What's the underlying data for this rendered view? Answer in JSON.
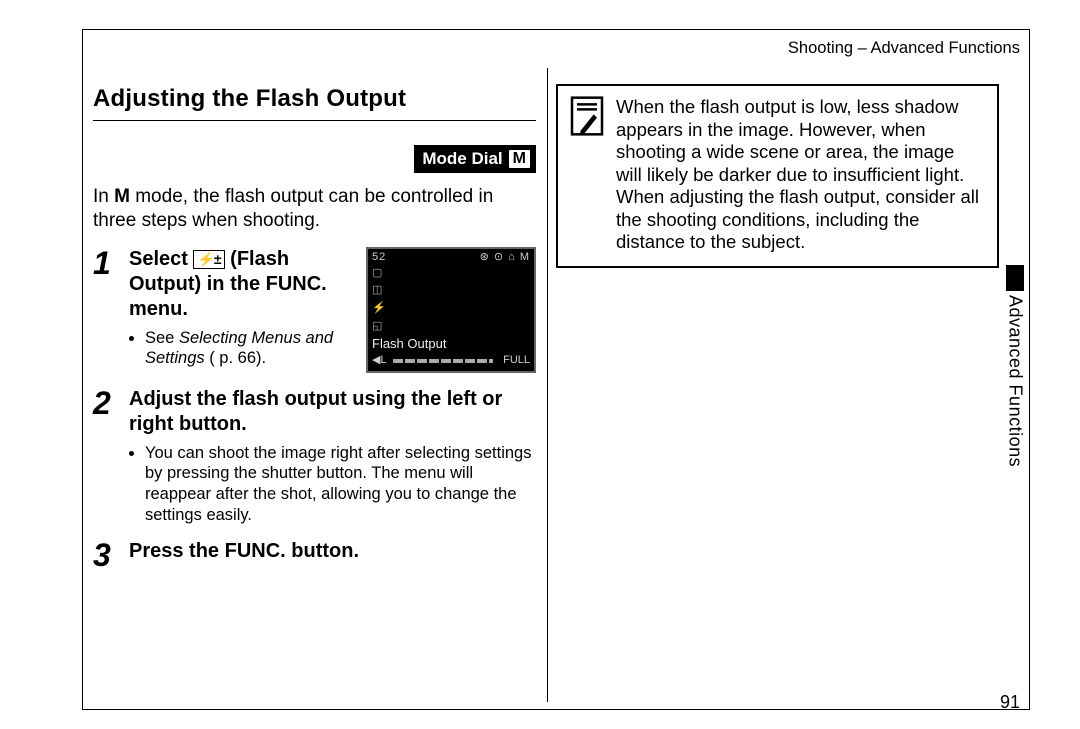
{
  "header": {
    "running_head": "Shooting – Advanced Functions"
  },
  "page": {
    "number": "91",
    "side_tab": "Advanced Functions"
  },
  "left": {
    "title": "Adjusting the Flash Output",
    "mode_badge_label": "Mode Dial",
    "mode_badge_value": "M",
    "intro_before": "In ",
    "intro_bold": "M",
    "intro_after": " mode, the flash output can be controlled in three steps when shooting.",
    "step1": {
      "num": "1",
      "before": "Select ",
      "icon_text": "⚡±",
      "after": " (Flash Output) in the FUNC. menu.",
      "sub_before": "See ",
      "sub_italic": "Selecting Menus and Settings",
      "sub_after": " p. 66)."
    },
    "lcd": {
      "top_left": "52",
      "top_right_icons": "⊛ ⊙ ⌂ M",
      "label": "Flash Output",
      "bottom_left": "◀L",
      "bottom_right": "FULL"
    },
    "step2": {
      "num": "2",
      "head": "Adjust the flash output using the left or right button.",
      "sub": "You can shoot the image right after selecting settings by pressing the shutter button. The menu will reappear after the shot, allowing you to change the settings easily."
    },
    "step3": {
      "num": "3",
      "head": "Press the FUNC. button."
    }
  },
  "right": {
    "note": "When the flash output is low, less shadow appears in the image. However, when shooting a wide scene or area, the image will likely be darker due to insufficient light. When adjusting the flash output, consider all the shooting conditions, including the distance to the subject."
  }
}
